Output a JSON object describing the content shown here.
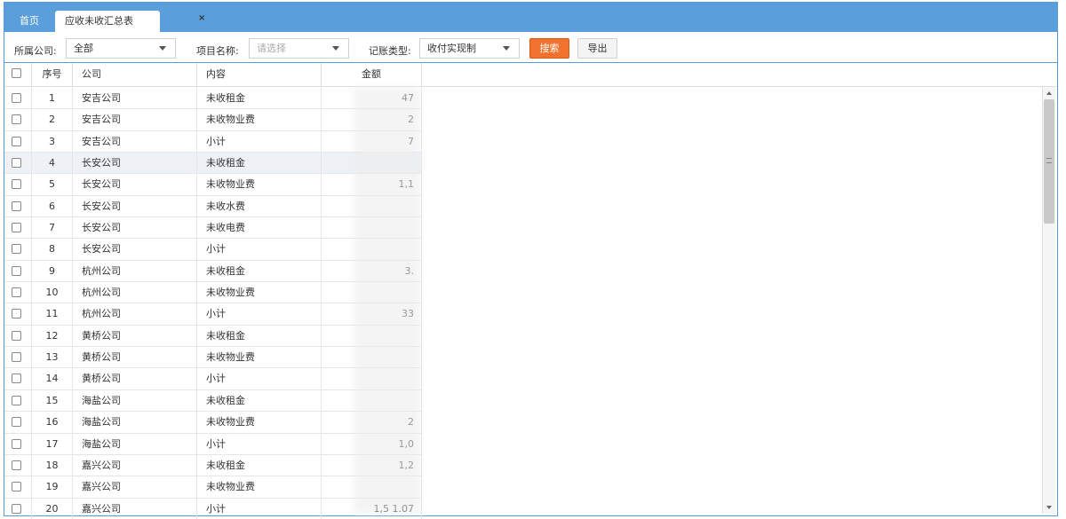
{
  "tabs": {
    "home": "首页",
    "active": "应收未收汇总表",
    "close": "×"
  },
  "filters": {
    "company_label": "所属公司:",
    "company_value": "全部",
    "project_label": "项目名称:",
    "project_placeholder": "请选择",
    "type_label": "记账类型:",
    "type_value": "收付实现制",
    "search_label": "搜索",
    "export_label": "导出"
  },
  "table": {
    "headers": {
      "index": "序号",
      "company": "公司",
      "content": "内容",
      "amount": "金额"
    },
    "rows": [
      {
        "index": "1",
        "company": "安吉公司",
        "content": "未收租金",
        "amount": "47"
      },
      {
        "index": "2",
        "company": "安吉公司",
        "content": "未收物业费",
        "amount": "2"
      },
      {
        "index": "3",
        "company": "安吉公司",
        "content": "小计",
        "amount": "7"
      },
      {
        "index": "4",
        "company": "长安公司",
        "content": "未收租金",
        "amount": ""
      },
      {
        "index": "5",
        "company": "长安公司",
        "content": "未收物业费",
        "amount": "1,1"
      },
      {
        "index": "6",
        "company": "长安公司",
        "content": "未收水费",
        "amount": ""
      },
      {
        "index": "7",
        "company": "长安公司",
        "content": "未收电费",
        "amount": ""
      },
      {
        "index": "8",
        "company": "长安公司",
        "content": "小计",
        "amount": ""
      },
      {
        "index": "9",
        "company": "杭州公司",
        "content": "未收租金",
        "amount": "3."
      },
      {
        "index": "10",
        "company": "杭州公司",
        "content": "未收物业费",
        "amount": ""
      },
      {
        "index": "11",
        "company": "杭州公司",
        "content": "小计",
        "amount": "33"
      },
      {
        "index": "12",
        "company": "黄桥公司",
        "content": "未收租金",
        "amount": ""
      },
      {
        "index": "13",
        "company": "黄桥公司",
        "content": "未收物业费",
        "amount": ""
      },
      {
        "index": "14",
        "company": "黄桥公司",
        "content": "小计",
        "amount": ""
      },
      {
        "index": "15",
        "company": "海盐公司",
        "content": "未收租金",
        "amount": ""
      },
      {
        "index": "16",
        "company": "海盐公司",
        "content": "未收物业费",
        "amount": "2"
      },
      {
        "index": "17",
        "company": "海盐公司",
        "content": "小计",
        "amount": "1,0"
      },
      {
        "index": "18",
        "company": "嘉兴公司",
        "content": "未收租金",
        "amount": "1,2"
      },
      {
        "index": "19",
        "company": "嘉兴公司",
        "content": "未收物业费",
        "amount": ""
      },
      {
        "index": "20",
        "company": "嘉兴公司",
        "content": "小计",
        "amount": "1,5   1.07"
      }
    ]
  },
  "colors": {
    "tabbar": "#5a9fdc",
    "search_button": "#f0722e",
    "border": "#5b9bd5"
  }
}
